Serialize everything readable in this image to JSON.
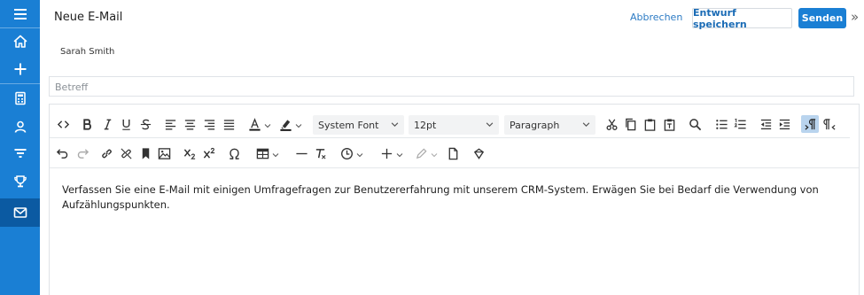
{
  "sidebar": {
    "icons": [
      "menu-icon",
      "home-icon",
      "plus-icon",
      "calculator-icon",
      "contacts-icon",
      "filter-icon",
      "trophy-icon",
      "mail-icon"
    ],
    "active": "mail-icon"
  },
  "header": {
    "title": "Neue E-Mail",
    "cancel_label": "Abbrechen",
    "draft_label": "Entwurf speichern",
    "send_label": "Senden",
    "collapse_glyph": "»"
  },
  "recipient": "Sarah Smith",
  "subject": {
    "placeholder": "Betreff"
  },
  "toolbar": {
    "font_family": "System Font",
    "font_size": "12pt",
    "block_format": "Paragraph"
  },
  "editor": {
    "text": "Verfassen Sie eine E-Mail mit einigen Umfragefragen zur Benutzererfahrung mit unserem CRM-System. Erwägen Sie bei Bedarf die Verwendung von Aufzählungspunkten."
  },
  "colors": {
    "sidebar": "#1a7fd4",
    "sidebar_active": "#0b5aa2",
    "primary_button": "#1a7fd4",
    "link": "#2c7bc4"
  }
}
